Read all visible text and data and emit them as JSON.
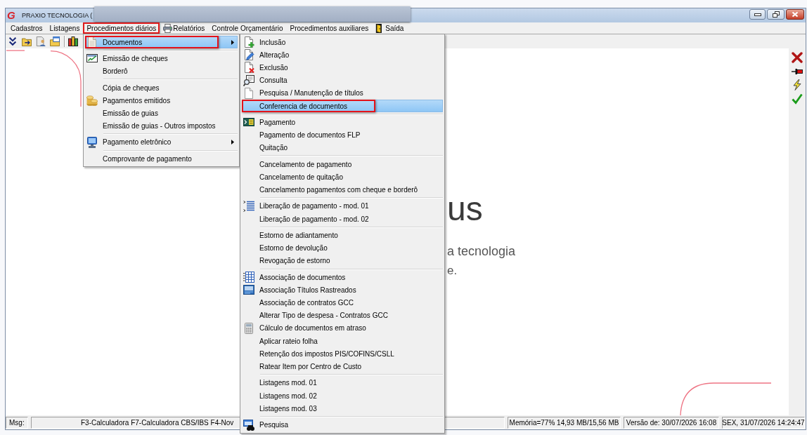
{
  "window": {
    "logo": "G",
    "title": "PRAXIO TECNOLOGIA ("
  },
  "menu_bar": [
    {
      "label": "Cadastros",
      "selected": false
    },
    {
      "label": "Listagens",
      "selected": false
    },
    {
      "label": "Procedimentos diários",
      "selected": true
    },
    {
      "label": "Relatórios",
      "selected": false
    },
    {
      "label": "Controle Orçamentário",
      "selected": false
    },
    {
      "label": "Procedimentos auxiliares",
      "selected": false
    },
    {
      "label": "Saída",
      "selected": false
    }
  ],
  "menu": {
    "groups": [
      [
        {
          "label": "Documentos",
          "selected": true,
          "marked": true,
          "has_submenu": true
        }
      ],
      [
        {
          "label": "Emissão de cheques",
          "selected": false,
          "marked": false,
          "has_submenu": false
        },
        {
          "label": "Borderô",
          "selected": false,
          "marked": false,
          "has_submenu": false
        }
      ],
      [
        {
          "label": "Cópia de cheques",
          "selected": false,
          "marked": false,
          "has_submenu": false
        },
        {
          "label": "Pagamentos emitidos",
          "selected": false,
          "marked": false,
          "has_submenu": false
        },
        {
          "label": "Emissão de guias",
          "selected": false,
          "marked": false,
          "has_submenu": false
        },
        {
          "label": "Emissão de guias - Outros impostos",
          "selected": false,
          "marked": false,
          "has_submenu": false
        }
      ],
      [
        {
          "label": "Pagamento eletrônico",
          "selected": false,
          "marked": false,
          "has_submenu": true
        }
      ],
      [
        {
          "label": "Comprovante de pagamento",
          "selected": false,
          "marked": false,
          "has_submenu": false
        }
      ]
    ]
  },
  "submenu": {
    "groups": [
      [
        {
          "label": "Inclusão",
          "selected": false,
          "marked": false
        },
        {
          "label": "Alteração",
          "selected": false,
          "marked": false
        },
        {
          "label": "Exclusão",
          "selected": false,
          "marked": false
        },
        {
          "label": "Consulta",
          "selected": false,
          "marked": false
        },
        {
          "label": "Pesquisa / Manutenção de títulos",
          "selected": false,
          "marked": false
        },
        {
          "label": "Conferencia de documentos",
          "selected": true,
          "marked": true
        }
      ],
      [
        {
          "label": "Pagamento",
          "selected": false,
          "marked": false
        },
        {
          "label": "Pagamento de documentos FLP",
          "selected": false,
          "marked": false
        },
        {
          "label": "Quitação",
          "selected": false,
          "marked": false
        }
      ],
      [
        {
          "label": "Cancelamento de pagamento",
          "selected": false,
          "marked": false
        },
        {
          "label": "Cancelamento de quitação",
          "selected": false,
          "marked": false
        },
        {
          "label": "Cancelamento pagamentos com cheque e borderô",
          "selected": false,
          "marked": false
        }
      ],
      [
        {
          "label": "Liberação de pagamento - mod. 01",
          "selected": false,
          "marked": false
        },
        {
          "label": "Liberação de pagamento - mod. 02",
          "selected": false,
          "marked": false
        }
      ],
      [
        {
          "label": "Estorno de adiantamento",
          "selected": false,
          "marked": false
        },
        {
          "label": "Estorno de devolução",
          "selected": false,
          "marked": false
        },
        {
          "label": "Revogação de estorno",
          "selected": false,
          "marked": false
        }
      ],
      [
        {
          "label": "Associação de documentos",
          "selected": false,
          "marked": false
        },
        {
          "label": "Associação Títulos Rastreados",
          "selected": false,
          "marked": false
        },
        {
          "label": "Associação de contratos GCC",
          "selected": false,
          "marked": false
        },
        {
          "label": "Alterar Tipo de despesa - Contratos GCC",
          "selected": false,
          "marked": false
        },
        {
          "label": "Cálculo de documentos em atraso",
          "selected": false,
          "marked": false
        },
        {
          "label": "Aplicar rateio folha",
          "selected": false,
          "marked": false
        },
        {
          "label": "Retenção dos impostos PIS/COFINS/CSLL",
          "selected": false,
          "marked": false
        },
        {
          "label": "Ratear Item por Centro de Custo",
          "selected": false,
          "marked": false
        }
      ],
      [
        {
          "label": "Listagens mod. 01",
          "selected": false,
          "marked": false
        },
        {
          "label": "Listagens mod. 02",
          "selected": false,
          "marked": false
        },
        {
          "label": "Listagens mod. 03",
          "selected": false,
          "marked": false
        }
      ],
      [
        {
          "label": "Pesquisa",
          "selected": false,
          "marked": false
        }
      ]
    ]
  },
  "welcome": {
    "heading": "us",
    "subtitle": "a tecnologia",
    "text": "e."
  },
  "status_bar": {
    "label": "Msg:",
    "message": "F3-Calculadora F7-Calculadora CBS/IBS F4-Nov",
    "memory": "Memória=77% 14,93 MB/15,56 MB",
    "version": "Versão de: 30/07/2026 16:08",
    "datetime": "SEX, 31/07/2026 14:24:47"
  }
}
